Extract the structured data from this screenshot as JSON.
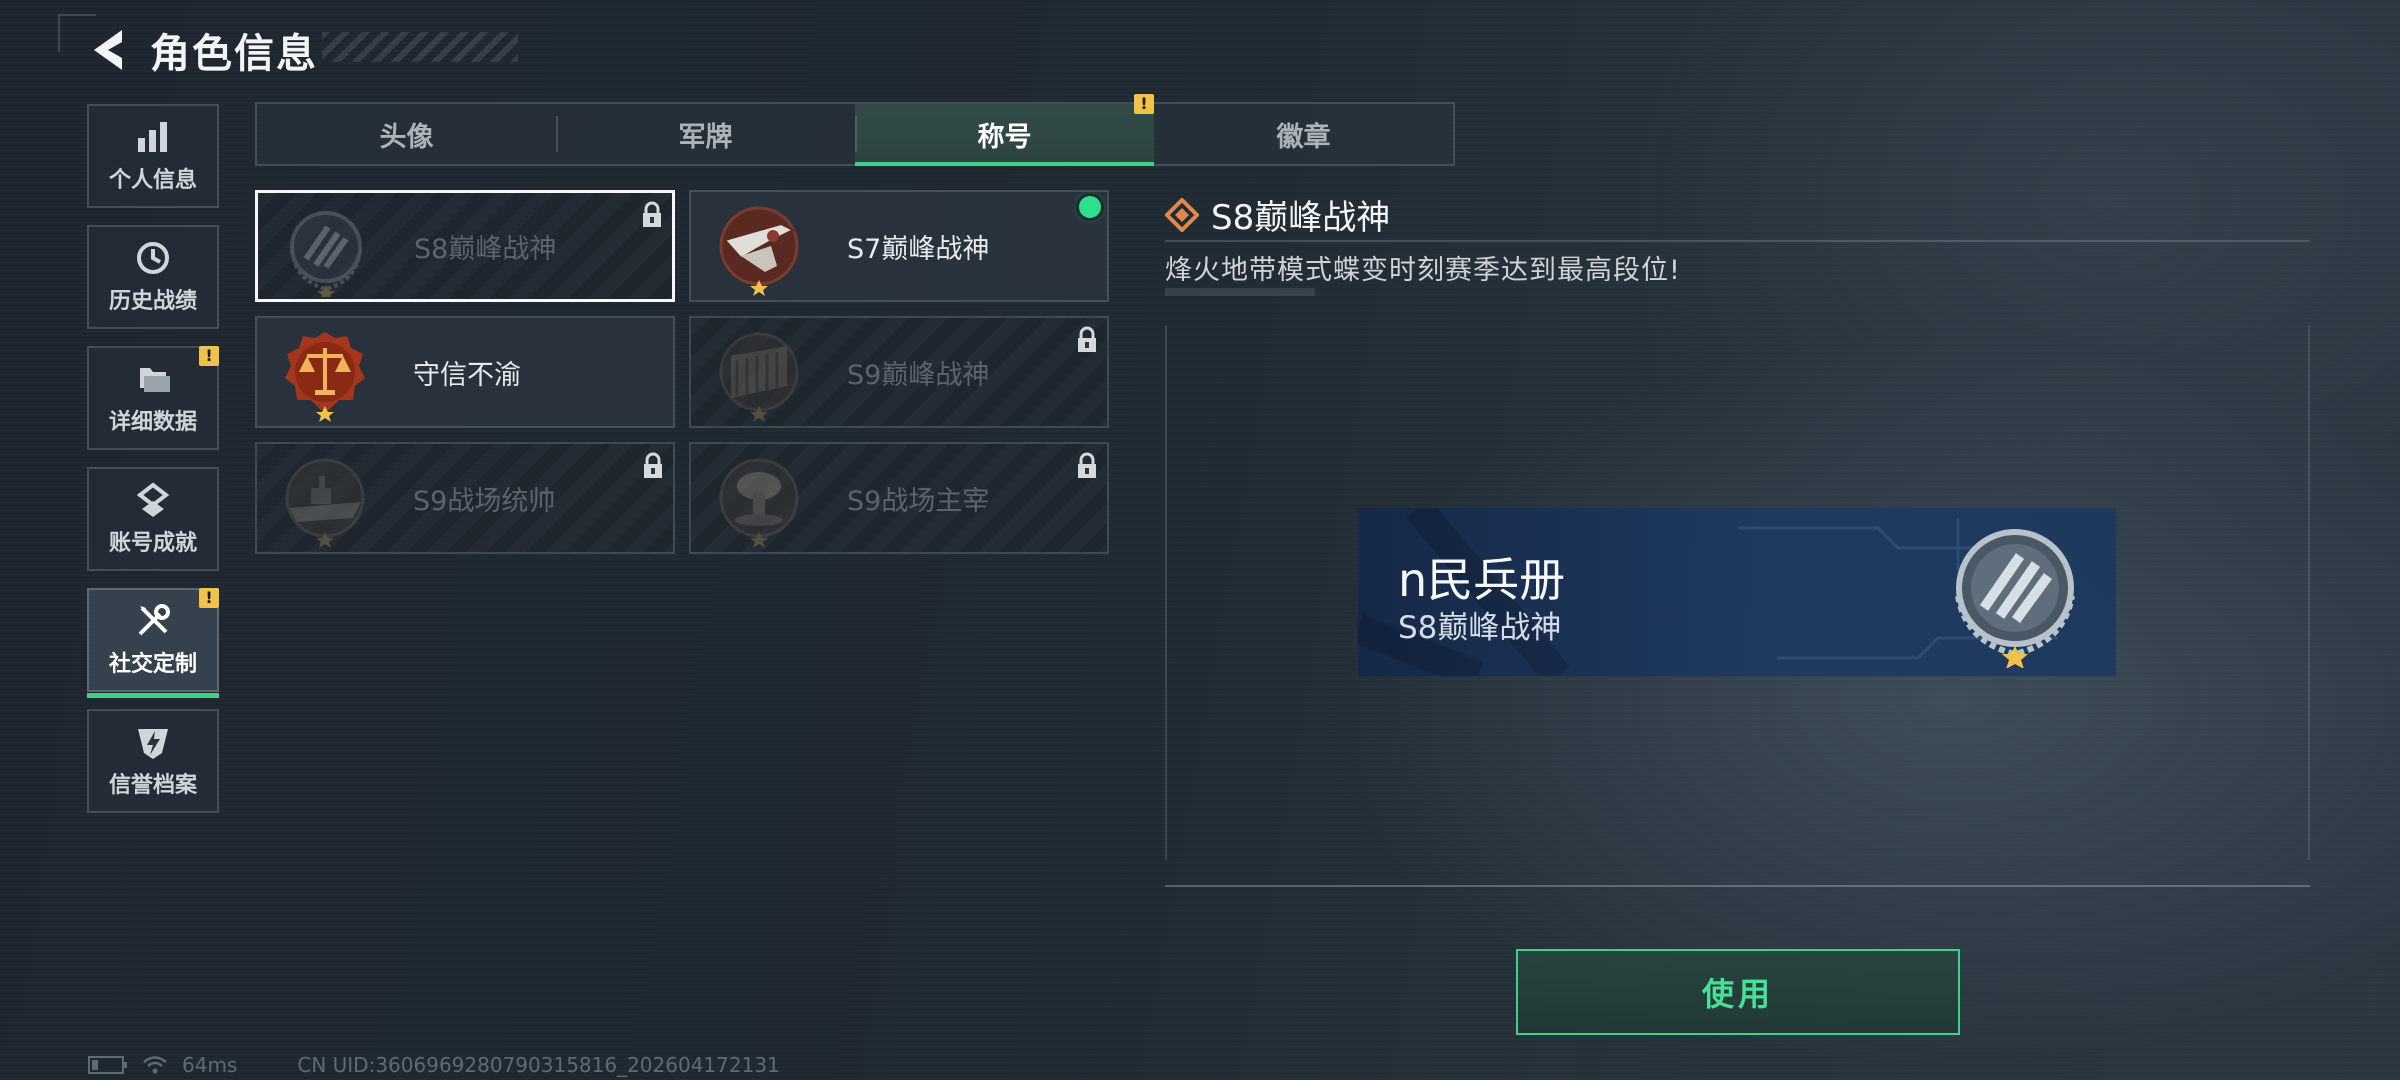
{
  "header": {
    "title": "角色信息"
  },
  "sidebar": {
    "items": [
      {
        "label": "个人信息",
        "icon": "bar-chart-icon"
      },
      {
        "label": "历史战绩",
        "icon": "history-clock-icon"
      },
      {
        "label": "详细数据",
        "icon": "folder-icon",
        "alert": "!"
      },
      {
        "label": "账号成就",
        "icon": "achievement-icon"
      },
      {
        "label": "社交定制",
        "icon": "tools-icon",
        "alert": "!",
        "active": true
      },
      {
        "label": "信誉档案",
        "icon": "shield-lightning-icon"
      }
    ]
  },
  "tabs": [
    {
      "label": "头像"
    },
    {
      "label": "军牌"
    },
    {
      "label": "称号",
      "active": true,
      "alert": "!"
    },
    {
      "label": "徽章"
    }
  ],
  "titles": [
    {
      "name": "S8巅峰战神",
      "locked": true,
      "selected": true,
      "emblem": "laurel-stripes-emblem"
    },
    {
      "name": "S7巅峰战神",
      "locked": false,
      "equipped": true,
      "emblem": "crossed-rifle-emblem"
    },
    {
      "name": "守信不渝",
      "locked": false,
      "emblem": "scales-emblem"
    },
    {
      "name": "S9巅峰战神",
      "locked": true,
      "emblem": "dam-emblem"
    },
    {
      "name": "S9战场统帅",
      "locked": true,
      "emblem": "warship-emblem"
    },
    {
      "name": "S9战场主宰",
      "locked": true,
      "emblem": "mushroom-cloud-emblem"
    }
  ],
  "detail": {
    "title": "S8巅峰战神",
    "description": "烽火地带模式蝶变时刻赛季达到最高段位!",
    "nameplate": {
      "player_name": "n民兵册",
      "title": "S8巅峰战神"
    },
    "use_button": "使用"
  },
  "status": {
    "latency": "64ms",
    "uid": "CN UID:3606969280790315816_202604172131"
  },
  "colors": {
    "accent": "#3fd08c",
    "alert": "#f0c24a",
    "equipped": "#2fe08a"
  }
}
